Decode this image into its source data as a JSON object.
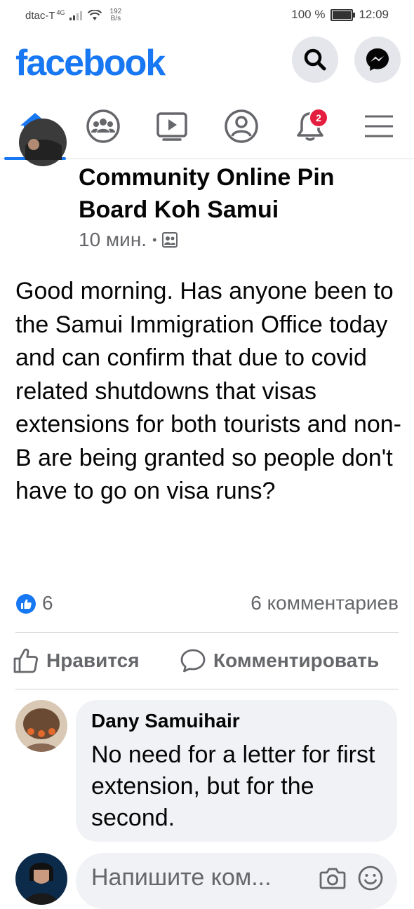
{
  "status_bar": {
    "carrier": "dtac-T",
    "network": "4G",
    "speed_value": "192",
    "speed_unit": "B/s",
    "battery": "100 %",
    "time": "12:09"
  },
  "header": {
    "logo": "facebook",
    "search_icon": "search-icon",
    "messenger_icon": "messenger-icon",
    "brand_color": "#1877f2"
  },
  "nav": {
    "items": [
      {
        "name": "home",
        "icon": "home-icon",
        "active": true
      },
      {
        "name": "groups",
        "icon": "groups-icon"
      },
      {
        "name": "watch",
        "icon": "watch-icon"
      },
      {
        "name": "profile",
        "icon": "profile-icon"
      },
      {
        "name": "notifications",
        "icon": "bell-icon",
        "badge": "2"
      },
      {
        "name": "menu",
        "icon": "menu-icon"
      }
    ]
  },
  "post": {
    "group_name": "Community Online Pin Board Koh Samui",
    "time": "10 мин.",
    "separator": "•",
    "audience_icon": "group-audience-icon",
    "text": "Good morning. Has anyone been to the Samui Immigration Office today and can confirm that due to covid related shutdowns that visas extensions for both tourists and non-B are being granted so people don't have to go on visa runs?",
    "like_count": "6",
    "comments_count": "6 комментариев",
    "like_label": "Нравится",
    "comment_label": "Комментировать"
  },
  "comment": {
    "author": "Dany Samuihair",
    "text": "No need for a letter for first extension, but for the second."
  },
  "composer": {
    "placeholder": "Напишите ком..."
  }
}
